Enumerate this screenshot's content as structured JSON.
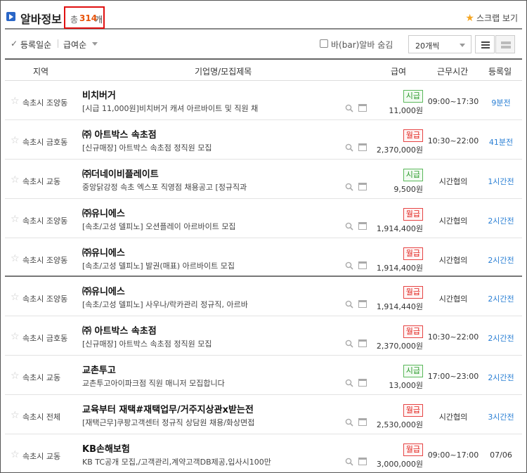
{
  "header": {
    "title": "알바정보",
    "total_label": "총",
    "total_count": "314",
    "total_unit": "개",
    "scrap_label": "스크랩 보기"
  },
  "sort": {
    "option1": "등록일순",
    "option2": "급여순",
    "bar_filter_label": "바(bar)알바 숨김",
    "per_page": "20개씩"
  },
  "columns": {
    "region": "지역",
    "company": "기업명/모집제목",
    "pay": "급여",
    "time": "근무시간",
    "date": "등록일"
  },
  "pay_types": {
    "hourly": "시급",
    "monthly": "월급"
  },
  "colors": {
    "accent_blue": "#2a66c7",
    "count_orange": "#e8540a",
    "highlight_red": "#e01010",
    "hourly_green": "#2a9a2a",
    "monthly_red": "#e0201a",
    "date_blue": "#2a7fd4"
  },
  "rows": [
    {
      "region": "속초시 조양동",
      "company": "비치버거",
      "title": "[시급 11,000원]비치버거 캐셔 아르바이트 및 직원 채",
      "pay_type": "시급",
      "pay": "11,000원",
      "time": "09:00~17:30",
      "date": "9분전"
    },
    {
      "region": "속초시 금호동",
      "company": "㈜ 아트박스 속초점",
      "title": "[신규매장] 아트박스 속초점 정직원 모집",
      "pay_type": "월급",
      "pay": "2,370,000원",
      "time": "10:30~22:00",
      "date": "41분전"
    },
    {
      "region": "속초시 교동",
      "company": "㈜더네이비플레이트",
      "title": "중앙닭강정 속초 엑스포 직영점 채용공고 [정규직과",
      "pay_type": "시급",
      "pay": "9,500원",
      "time": "시간협의",
      "date": "1시간전"
    },
    {
      "region": "속초시 조양동",
      "company": "㈜유니에스",
      "title": "[속초/고성 델피노] 오션플레이 아르바이트 모집",
      "pay_type": "월급",
      "pay": "1,914,400원",
      "time": "시간협의",
      "date": "2시간전"
    },
    {
      "region": "속초시 조양동",
      "company": "㈜유니에스",
      "title": "[속초/고성 델피노] 발권(매표) 아르바이트 모집",
      "pay_type": "월급",
      "pay": "1,914,400원",
      "time": "시간협의",
      "date": "2시간전"
    },
    {
      "region": "속초시 조양동",
      "company": "㈜유니에스",
      "title": "[속초/고성 델피노] 사우나/락카관리 정규직, 아르바",
      "pay_type": "월급",
      "pay": "1,914,440원",
      "time": "시간협의",
      "date": "2시간전"
    },
    {
      "region": "속초시 금호동",
      "company": "㈜ 아트박스 속초점",
      "title": "[신규매장] 아트박스 속초점 정직원 모집",
      "pay_type": "월급",
      "pay": "2,370,000원",
      "time": "10:30~22:00",
      "date": "2시간전"
    },
    {
      "region": "속초시 교동",
      "company": "교촌투고",
      "title": "교촌투고아이파크점 직원 매니저 모집합니다",
      "pay_type": "시급",
      "pay": "13,000원",
      "time": "17:00~23:00",
      "date": "2시간전"
    },
    {
      "region": "속초시 전체",
      "company": "교육부터 재택#재택업무/거주지상관x받는전",
      "title": "[재택근무]쿠팡고객센터 정규직 상담원 채용/화상면접",
      "pay_type": "월급",
      "pay": "2,530,000원",
      "time": "시간협의",
      "date": "3시간전"
    },
    {
      "region": "속초시 교동",
      "company": "KB손해보험",
      "title": "KB TC공개 모집,/고객관리,계약고객DB제공,입사시100만",
      "pay_type": "월급",
      "pay": "3,000,000원",
      "time": "09:00~17:00",
      "date": "07/06"
    }
  ]
}
